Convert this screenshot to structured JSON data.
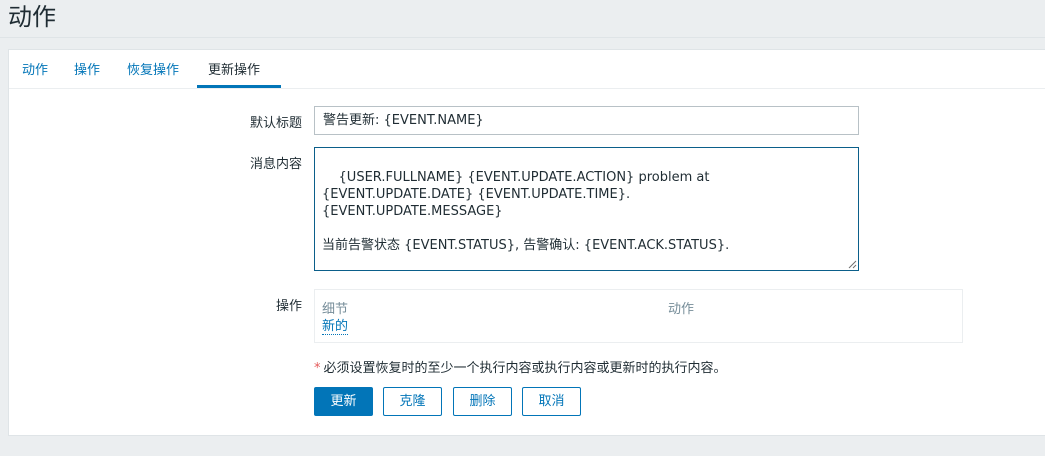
{
  "page": {
    "title": "动作"
  },
  "tabs": [
    {
      "label": "动作"
    },
    {
      "label": "操作"
    },
    {
      "label": "恢复操作"
    },
    {
      "label": "更新操作",
      "active": true
    }
  ],
  "form": {
    "default_subject": {
      "label": "默认标题",
      "value": "警告更新: {EVENT.NAME}"
    },
    "message": {
      "label": "消息内容",
      "value": "{USER.FULLNAME} {EVENT.UPDATE.ACTION} problem at\n{EVENT.UPDATE.DATE} {EVENT.UPDATE.TIME}.\n{EVENT.UPDATE.MESSAGE}\n\n当前告警状态 {EVENT.STATUS}, 告警确认: {EVENT.ACK.STATUS}."
    },
    "operations": {
      "label": "操作",
      "col_details": "细节",
      "col_action": "动作",
      "new_link": "新的"
    },
    "warning": {
      "star": "*",
      "text": "必须设置恢复时的至少一个执行内容或执行内容或更新时的执行内容。"
    }
  },
  "buttons": {
    "update": "更新",
    "clone": "克隆",
    "delete": "删除",
    "cancel": "取消"
  },
  "colors": {
    "accent": "#0275b8",
    "required": "#e45959",
    "background": "#ebeef0"
  }
}
